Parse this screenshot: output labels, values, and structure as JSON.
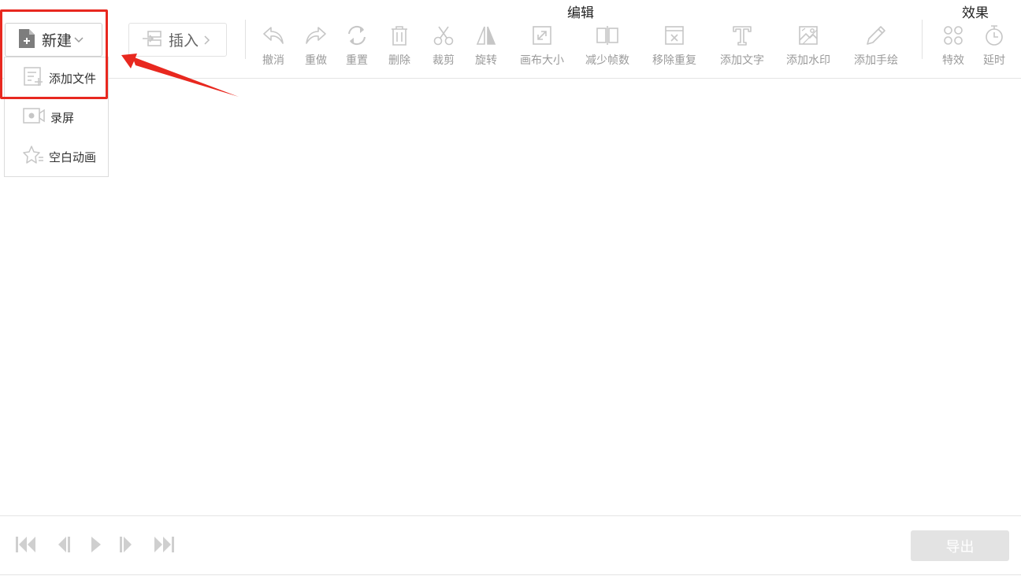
{
  "groups": {
    "edit": "编辑",
    "effects": "效果"
  },
  "new_button": {
    "label": "新建"
  },
  "insert_button": {
    "label": "插入"
  },
  "tools": {
    "undo": "撤消",
    "redo": "重做",
    "reset": "重置",
    "delete": "删除",
    "crop": "裁剪",
    "rotate": "旋转",
    "canvas_size": "画布大小",
    "reduce_frames": "减少帧数",
    "remove_duplicates": "移除重复",
    "add_text": "添加文字",
    "add_watermark": "添加水印",
    "add_drawing": "添加手绘",
    "effects": "特效",
    "delay": "延时"
  },
  "dropdown": {
    "items": [
      "添加文件",
      "录屏",
      "空白动画"
    ]
  },
  "playback": {
    "icons": [
      "skip-first-icon",
      "step-back-icon",
      "play-icon",
      "step-forward-icon",
      "skip-last-icon"
    ]
  },
  "export_button": {
    "label": "导出"
  },
  "colors": {
    "highlight": "#e8281f",
    "icon_gray": "#c6c6c6",
    "export_bg": "#e3e3e3"
  }
}
